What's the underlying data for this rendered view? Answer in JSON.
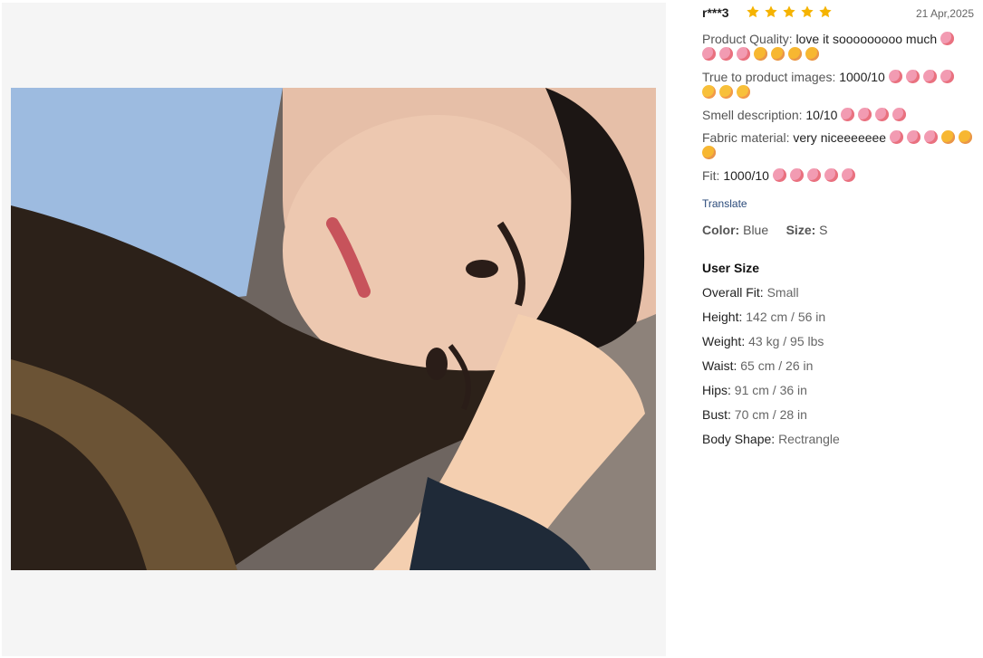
{
  "review": {
    "username": "r***3",
    "rating": 5,
    "date": "21 Apr,2025",
    "lines": [
      {
        "key": "Product Quality:",
        "value": " love it sooooooooo much",
        "emoji_line1": [
          "e1"
        ],
        "emoji_line2": [
          "e1",
          "e1",
          "e1",
          "e2",
          "e2",
          "e2",
          "e2"
        ]
      },
      {
        "key": "True to product images:",
        "value": " 1000/10",
        "emoji_line1": [
          "e1",
          "e1",
          "e1",
          "e1"
        ],
        "emoji_line2": [
          "e3",
          "e3",
          "e3"
        ]
      },
      {
        "key": "Smell description:",
        "value": " 10/10",
        "emoji_line1": [
          "e1",
          "e1",
          "e1",
          "e1"
        ]
      },
      {
        "key": "Fabric material:",
        "value": " very niceeeeeee",
        "emoji_line1": [
          "e1",
          "e1",
          "e1",
          "e2",
          "e2"
        ],
        "emoji_line2": [
          "e2"
        ]
      },
      {
        "key": "Fit:",
        "value": " 1000/10",
        "emoji_line1": [
          "e1",
          "e1",
          "e1",
          "e1",
          "e1"
        ]
      }
    ],
    "translate_label": "Translate",
    "color_label": "Color:",
    "color_value": "Blue",
    "size_label": "Size:",
    "size_value": "S",
    "user_size_title": "User Size",
    "user_size": [
      {
        "label": "Overall Fit:",
        "value": "Small"
      },
      {
        "label": "Height:",
        "value": "142 cm / 56 in"
      },
      {
        "label": "Weight:",
        "value": "43 kg / 95 lbs"
      },
      {
        "label": "Waist:",
        "value": "65 cm / 26 in"
      },
      {
        "label": "Hips:",
        "value": "91 cm / 36 in"
      },
      {
        "label": "Bust:",
        "value": "70 cm / 28 in"
      },
      {
        "label": "Body Shape:",
        "value": "Rectrangle"
      }
    ]
  },
  "colors": {
    "star": "#f5b301",
    "panel_bg": "#f5f5f5",
    "translate": "#2a4a7a"
  },
  "icons": {
    "star": "star-icon",
    "emoji": "emoji-icon"
  }
}
